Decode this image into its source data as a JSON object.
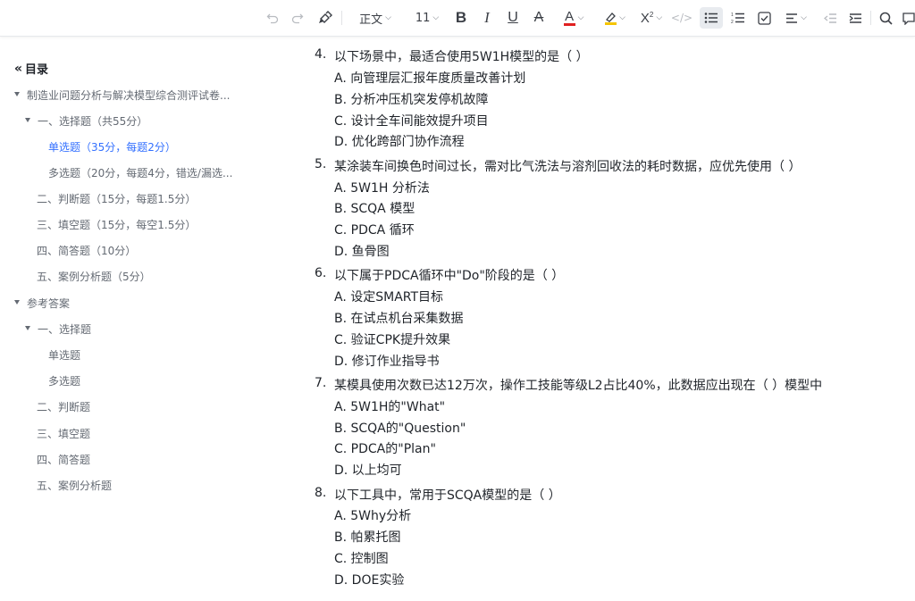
{
  "toolbar": {
    "style_label": "正文",
    "font_size": "11"
  },
  "sidebar": {
    "title": "目录",
    "items": [
      {
        "label": "制造业问题分析与解决模型综合测评试卷..."
      },
      {
        "label": "一、选择题（共55分）"
      },
      {
        "label": "单选题（35分，每题2分）"
      },
      {
        "label": "多选题（20分，每题4分，错选/漏选..."
      },
      {
        "label": "二、判断题（15分，每题1.5分）"
      },
      {
        "label": "三、填空题（15分，每空1.5分）"
      },
      {
        "label": "四、简答题（10分）"
      },
      {
        "label": "五、案例分析题（5分）"
      },
      {
        "label": "参考答案"
      },
      {
        "label": "一、选择题"
      },
      {
        "label": "单选题"
      },
      {
        "label": "多选题"
      },
      {
        "label": "二、判断题"
      },
      {
        "label": "三、填空题"
      },
      {
        "label": "四、简答题"
      },
      {
        "label": "五、案例分析题"
      }
    ]
  },
  "questions": [
    {
      "num": "4.",
      "text": "以下场景中，最适合使用5W1H模型的是（ ）",
      "options": [
        "A. 向管理层汇报年度质量改善计划",
        "B. 分析冲压机突发停机故障",
        "C. 设计全车间能效提升项目",
        "D. 优化跨部门协作流程"
      ]
    },
    {
      "num": "5.",
      "text": "某涂装车间换色时间过长，需对比气洗法与溶剂回收法的耗时数据，应优先使用（ ）",
      "options": [
        "A. 5W1H 分析法",
        "B. SCQA 模型",
        "C. PDCA 循环",
        "D. 鱼骨图"
      ]
    },
    {
      "num": "6.",
      "text": "以下属于PDCA循环中\"Do\"阶段的是（ ）",
      "options": [
        "A. 设定SMART目标",
        "B. 在试点机台采集数据",
        "C. 验证CPK提升效果",
        "D. 修订作业指导书"
      ]
    },
    {
      "num": "7.",
      "text": "某模具使用次数已达12万次，操作工技能等级L2占比40%，此数据应出现在（ ）模型中",
      "options": [
        "A. 5W1H的\"What\"",
        "B. SCQA的\"Question\"",
        "C. PDCA的\"Plan\"",
        "D. 以上均可"
      ]
    },
    {
      "num": "8.",
      "text": "以下工具中，常用于SCQA模型的是（ ）",
      "options": [
        "A. 5Why分析",
        "B. 帕累托图",
        "C. 控制图",
        "D. DOE实验"
      ]
    }
  ]
}
